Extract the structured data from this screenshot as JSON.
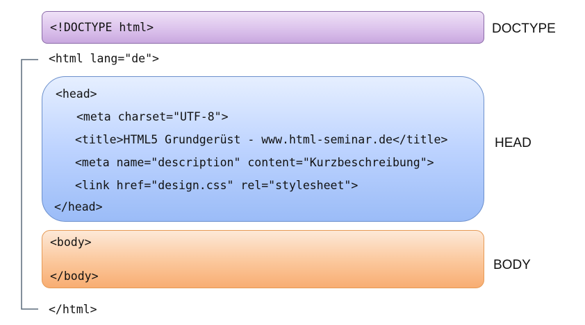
{
  "doctype": {
    "code": "<!DOCTYPE html>",
    "label": "DOCTYPE"
  },
  "html": {
    "open": "<html lang=\"de\">",
    "close": "</html>"
  },
  "head": {
    "label": "HEAD",
    "open": "<head>",
    "lines": [
      "<meta charset=\"UTF-8\">",
      "<title>HTML5 Grundgerüst - www.html-seminar.de</title>",
      "<meta name=\"description\" content=\"Kurzbeschreibung\">",
      "<link href=\"design.css\" rel=\"stylesheet\">"
    ],
    "close": "</head>"
  },
  "body": {
    "label": "BODY",
    "open": "<body>",
    "close": "</body>"
  },
  "colors": {
    "doctype_fill": "#dcc3ec",
    "head_fill": "#bdd3ff",
    "body_fill": "#fbc79b",
    "bracket": "#5a6a7a"
  }
}
